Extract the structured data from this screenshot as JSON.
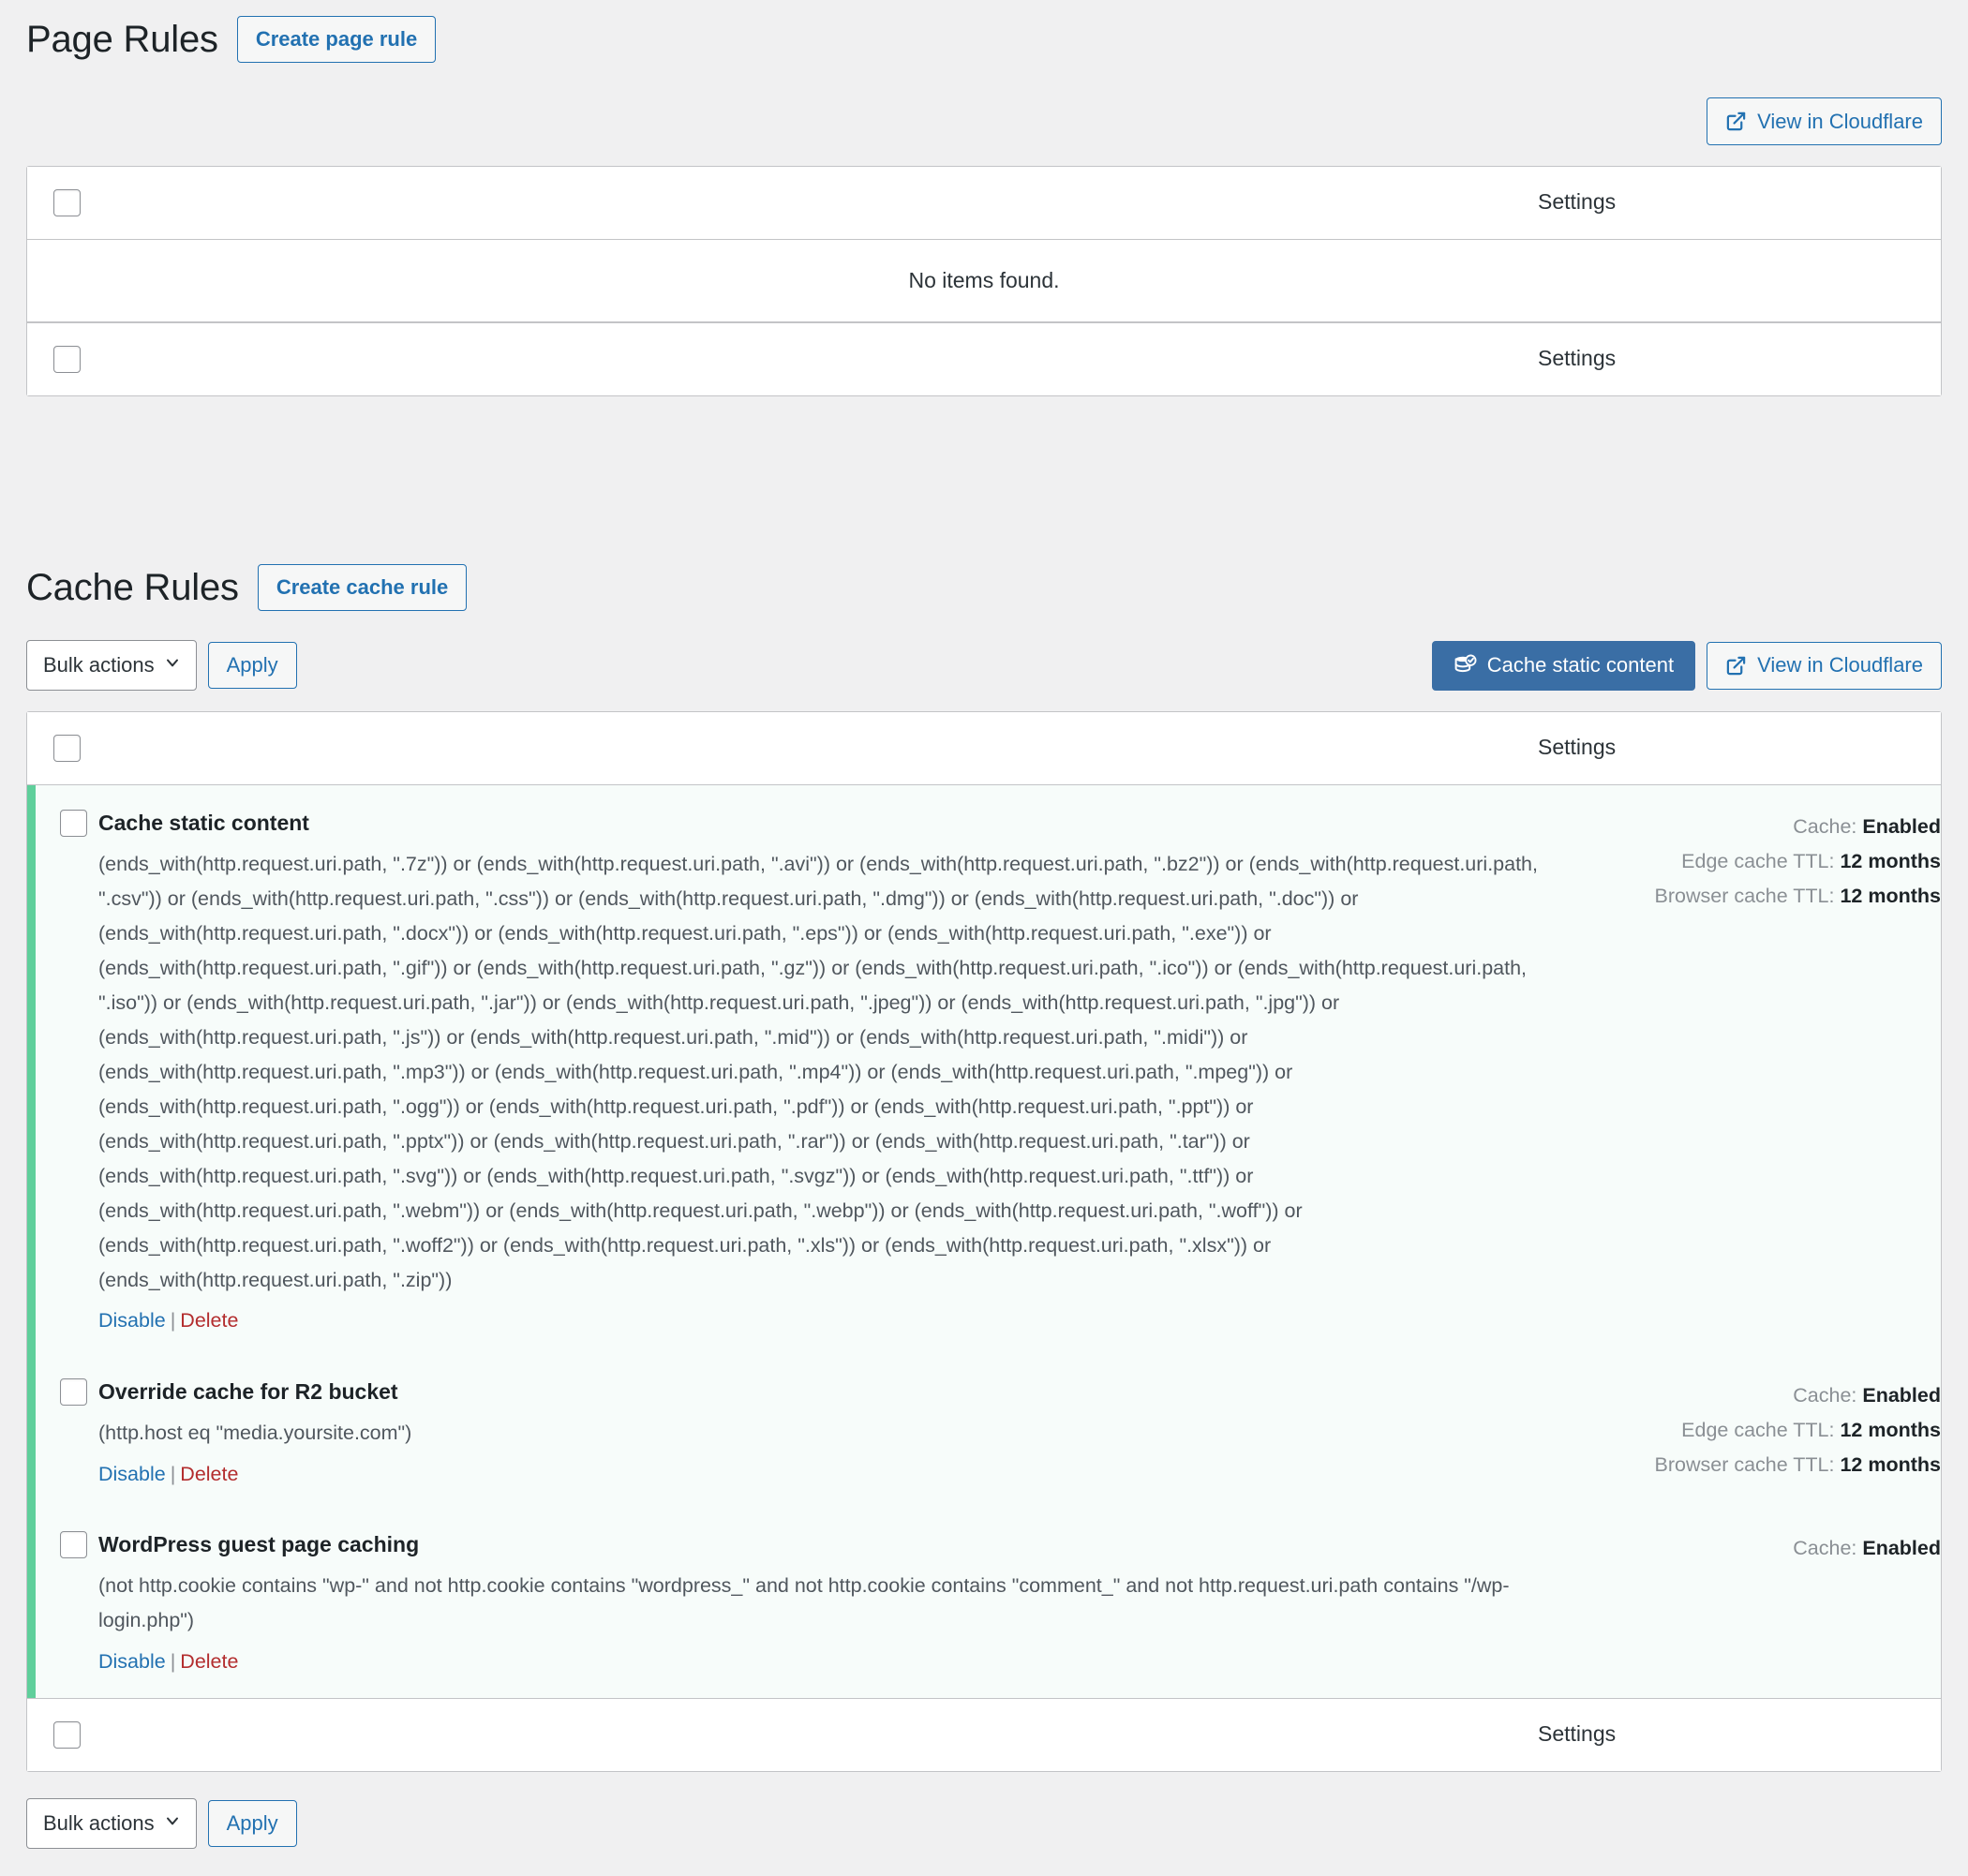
{
  "page_rules": {
    "title": "Page Rules",
    "create_button": "Create page rule",
    "view_button": "View in Cloudflare",
    "view_icon": "external-link-icon",
    "header_settings": "Settings",
    "footer_settings": "Settings",
    "empty_message": "No items found."
  },
  "cache_rules": {
    "title": "Cache Rules",
    "create_button": "Create cache rule",
    "bulk_actions_label": "Bulk actions",
    "apply_label": "Apply",
    "cache_static_button": "Cache static content",
    "cache_static_icon": "database-check-icon",
    "view_button": "View in Cloudflare",
    "view_icon": "external-link-icon",
    "header_settings": "Settings",
    "footer_settings": "Settings",
    "bottom_bulk_actions_label": "Bulk actions",
    "bottom_apply_label": "Apply",
    "action_disable": "Disable",
    "action_delete": "Delete",
    "action_separator": "|",
    "accent_color": "#5fcf9b",
    "row_background": "#f7fcfa",
    "rows": [
      {
        "name": "Cache static content",
        "expression": "(ends_with(http.request.uri.path, \".7z\")) or (ends_with(http.request.uri.path, \".avi\")) or (ends_with(http.request.uri.path, \".bz2\")) or (ends_with(http.request.uri.path, \".csv\")) or (ends_with(http.request.uri.path, \".css\")) or (ends_with(http.request.uri.path, \".dmg\")) or (ends_with(http.request.uri.path, \".doc\")) or (ends_with(http.request.uri.path, \".docx\")) or (ends_with(http.request.uri.path, \".eps\")) or (ends_with(http.request.uri.path, \".exe\")) or (ends_with(http.request.uri.path, \".gif\")) or (ends_with(http.request.uri.path, \".gz\")) or (ends_with(http.request.uri.path, \".ico\")) or (ends_with(http.request.uri.path, \".iso\")) or (ends_with(http.request.uri.path, \".jar\")) or (ends_with(http.request.uri.path, \".jpeg\")) or (ends_with(http.request.uri.path, \".jpg\")) or (ends_with(http.request.uri.path, \".js\")) or (ends_with(http.request.uri.path, \".mid\")) or (ends_with(http.request.uri.path, \".midi\")) or (ends_with(http.request.uri.path, \".mp3\")) or (ends_with(http.request.uri.path, \".mp4\")) or (ends_with(http.request.uri.path, \".mpeg\")) or (ends_with(http.request.uri.path, \".ogg\")) or (ends_with(http.request.uri.path, \".pdf\")) or (ends_with(http.request.uri.path, \".ppt\")) or (ends_with(http.request.uri.path, \".pptx\")) or (ends_with(http.request.uri.path, \".rar\")) or (ends_with(http.request.uri.path, \".tar\")) or (ends_with(http.request.uri.path, \".svg\")) or (ends_with(http.request.uri.path, \".svgz\")) or (ends_with(http.request.uri.path, \".ttf\")) or (ends_with(http.request.uri.path, \".webm\")) or (ends_with(http.request.uri.path, \".webp\")) or (ends_with(http.request.uri.path, \".woff\")) or (ends_with(http.request.uri.path, \".woff2\")) or (ends_with(http.request.uri.path, \".xls\")) or (ends_with(http.request.uri.path, \".xlsx\")) or (ends_with(http.request.uri.path, \".zip\"))",
        "settings": [
          {
            "label": "Cache:",
            "value": "Enabled"
          },
          {
            "label": "Edge cache TTL:",
            "value": "12 months"
          },
          {
            "label": "Browser cache TTL:",
            "value": "12 months"
          }
        ]
      },
      {
        "name": "Override cache for R2 bucket",
        "expression": "(http.host eq \"media.yoursite.com\")",
        "settings": [
          {
            "label": "Cache:",
            "value": "Enabled"
          },
          {
            "label": "Edge cache TTL:",
            "value": "12 months"
          },
          {
            "label": "Browser cache TTL:",
            "value": "12 months"
          }
        ]
      },
      {
        "name": "WordPress guest page caching",
        "expression": "(not http.cookie contains \"wp-\" and not http.cookie contains \"wordpress_\" and not http.cookie contains \"comment_\" and not http.request.uri.path contains \"/wp-login.php\")",
        "settings": [
          {
            "label": "Cache:",
            "value": "Enabled"
          }
        ]
      }
    ]
  }
}
